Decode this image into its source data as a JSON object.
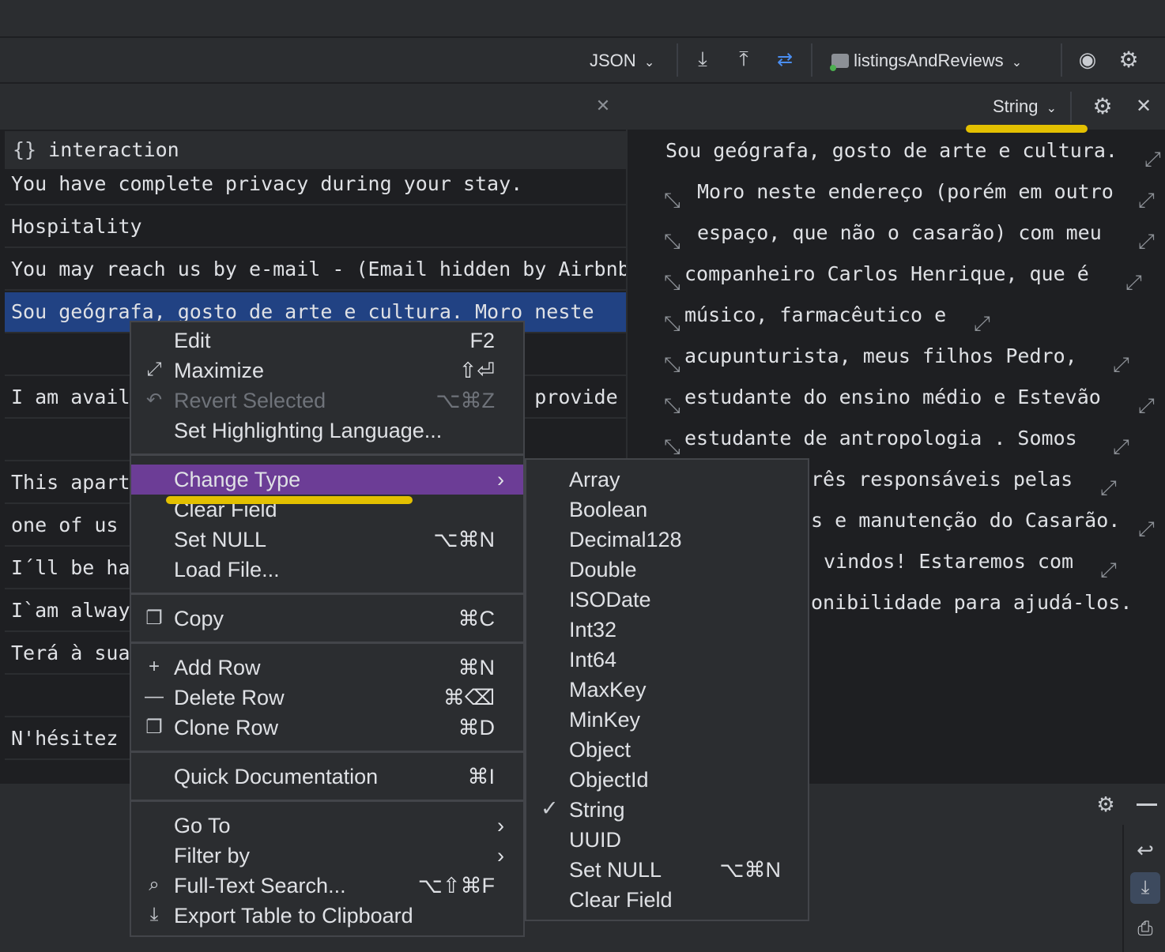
{
  "toolbar": {
    "format_label": "JSON",
    "collection_label": "listingsAndReviews"
  },
  "left_panel": {
    "header_field": "interaction",
    "rows": [
      "You have complete privacy during your stay.",
      "Hospitality",
      "You may reach us by e-mail - (Email hidden by Airbnb)",
      "Sou geógrafa, gosto de arte e cultura. Moro neste",
      "",
      "I am available to answer questions and will provide",
      "",
      "This apartment",
      "one of us",
      "I´ll be happy",
      "I`am always",
      "Terá à sua",
      "",
      "N'hésitez"
    ]
  },
  "right_panel": {
    "type_label": "String",
    "lines": [
      "Sou geógrafa, gosto de arte e cultura.",
      "Moro neste endereço (porém em outro",
      "espaço, que não o casarão) com meu",
      "companheiro Carlos Henrique, que é",
      "músico, farmacêutico e",
      "acupunturista, meus filhos Pedro,",
      "estudante do ensino médio e Estevão",
      "estudante de antropologia . Somos",
      "rês responsáveis pelas",
      "s e manutenção do Casarão.",
      "vindos! Estaremos com",
      "onibilidade para ajudá-los."
    ]
  },
  "context_menu": {
    "items": [
      {
        "label": "Edit",
        "shortcut": "F2",
        "icon": "",
        "disabled": false
      },
      {
        "label": "Maximize",
        "shortcut": "⇧⏎",
        "icon": "maximize-icon",
        "disabled": false
      },
      {
        "label": "Revert Selected",
        "shortcut": "⌥⌘Z",
        "icon": "revert-icon",
        "disabled": true
      },
      {
        "label": "Set Highlighting Language...",
        "shortcut": "",
        "icon": "",
        "disabled": false
      },
      {
        "label": "Change Type",
        "shortcut": "",
        "icon": "",
        "disabled": false,
        "active": true
      },
      {
        "label": "Clear Field",
        "shortcut": "",
        "icon": "",
        "disabled": false
      },
      {
        "label": "Set NULL",
        "shortcut": "⌥⌘N",
        "icon": "",
        "disabled": false
      },
      {
        "label": "Load File...",
        "shortcut": "",
        "icon": "",
        "disabled": false
      },
      {
        "label": "Copy",
        "shortcut": "⌘C",
        "icon": "copy-icon",
        "disabled": false
      },
      {
        "label": "Add Row",
        "shortcut": "⌘N",
        "icon": "plus-icon",
        "disabled": false
      },
      {
        "label": "Delete Row",
        "shortcut": "⌘⌫",
        "icon": "minus-icon",
        "disabled": false
      },
      {
        "label": "Clone Row",
        "shortcut": "⌘D",
        "icon": "clone-icon",
        "disabled": false
      },
      {
        "label": "Quick Documentation",
        "shortcut": "⌘I",
        "icon": "",
        "disabled": false
      },
      {
        "label": "Go To",
        "shortcut": "",
        "icon": "",
        "disabled": false
      },
      {
        "label": "Filter by",
        "shortcut": "",
        "icon": "",
        "disabled": false
      },
      {
        "label": "Full-Text Search...",
        "shortcut": "⌥⇧⌘F",
        "icon": "search-icon",
        "disabled": false
      },
      {
        "label": "Export Table to Clipboard",
        "shortcut": "",
        "icon": "export-icon",
        "disabled": false
      }
    ]
  },
  "submenu": {
    "items": [
      {
        "label": "Array",
        "shortcut": ""
      },
      {
        "label": "Boolean",
        "shortcut": ""
      },
      {
        "label": "Decimal128",
        "shortcut": ""
      },
      {
        "label": "Double",
        "shortcut": ""
      },
      {
        "label": "ISODate",
        "shortcut": ""
      },
      {
        "label": "Int32",
        "shortcut": ""
      },
      {
        "label": "Int64",
        "shortcut": ""
      },
      {
        "label": "MaxKey",
        "shortcut": ""
      },
      {
        "label": "MinKey",
        "shortcut": ""
      },
      {
        "label": "Object",
        "shortcut": ""
      },
      {
        "label": "ObjectId",
        "shortcut": ""
      },
      {
        "label": "String",
        "shortcut": "",
        "checked": true
      },
      {
        "label": "UUID",
        "shortcut": ""
      },
      {
        "label": "Set NULL",
        "shortcut": "⌥⌘N"
      },
      {
        "label": "Clear Field",
        "shortcut": ""
      }
    ]
  },
  "colors": {
    "accent_highlight": "#e3c000",
    "menu_active": "#6c3d96",
    "row_selected": "#214283"
  }
}
